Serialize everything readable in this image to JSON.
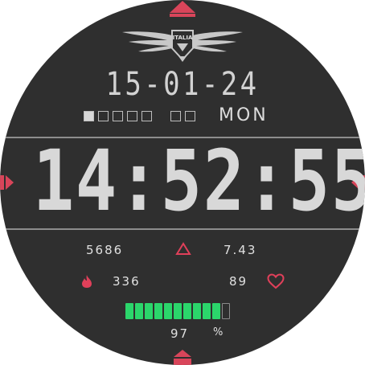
{
  "watch": {
    "date": "15-01-24",
    "weekday": "MON",
    "week_boxes": [
      true,
      false,
      false,
      false,
      false,
      false,
      false
    ],
    "time": "14:52:55",
    "steps": "5686",
    "distance": "7.43",
    "calories": "336",
    "heart_rate": "89",
    "battery_percent": "97",
    "battery_unit": "%",
    "battery_level": 0.9,
    "logo_text": "ITALIA"
  },
  "colors": {
    "face": "#2f2f2f",
    "accent_red": "#d9455a",
    "battery_green": "#2bd66b",
    "text": "#d8d8d8"
  },
  "icons": [
    "top-marker-icon",
    "winged-badge-logo",
    "triangle-icon",
    "flame-icon",
    "heart-icon",
    "side-marker-icon",
    "bottom-marker-icon"
  ]
}
